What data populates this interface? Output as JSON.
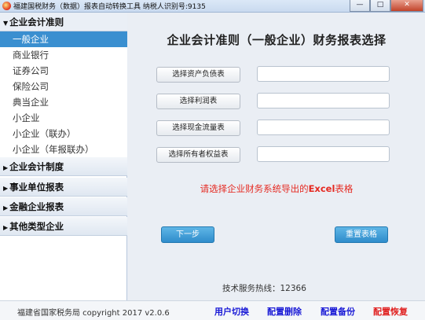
{
  "window": {
    "title": "福建国税财务（数据）报表自动转换工具     纳税人识别号:9135",
    "minimize": "—",
    "maximize": "□",
    "close": "✕"
  },
  "sidebar": {
    "categories": [
      {
        "label": "企业会计准则",
        "expanded": true,
        "arrow": "▼"
      },
      {
        "label": "企业会计制度",
        "expanded": false,
        "arrow": "▶"
      },
      {
        "label": "事业单位报表",
        "expanded": false,
        "arrow": "▶"
      },
      {
        "label": "金融企业报表",
        "expanded": false,
        "arrow": "▶"
      },
      {
        "label": "其他类型企业",
        "expanded": false,
        "arrow": "▶"
      }
    ],
    "sub_items": [
      "一般企业",
      "商业银行",
      "证券公司",
      "保险公司",
      "典当企业",
      "小企业",
      "小企业（联办）",
      "小企业（年报联办）"
    ],
    "selected_index": 0
  },
  "main": {
    "title": "企业会计准则（一般企业）财务报表选择",
    "select_buttons": [
      "选择资产负债表",
      "选择利润表",
      "选择现金流量表",
      "选择所有者权益表"
    ],
    "input_values": [
      "",
      "",
      "",
      ""
    ],
    "hint_prefix": "请选择企业财务系统导出的",
    "hint_excel": "Excel",
    "hint_suffix": "表格",
    "next_button": "下一步",
    "reset_button": "重置表格",
    "hotline": "技术服务热线：12366"
  },
  "statusbar": {
    "copyright": "福建省国家税务局  copyright 2017  v2.0.6",
    "links": [
      {
        "label": "用户切换",
        "color": "#1a1ad6"
      },
      {
        "label": "配置删除",
        "color": "#1a1ad6"
      },
      {
        "label": "配置备份",
        "color": "#1a1ad6"
      },
      {
        "label": "配置恢复",
        "color": "#e02020"
      }
    ]
  },
  "colors": {
    "accent": "#3a8fd0",
    "hint_red": "#e52a22",
    "button_blue": "#2f8ccb"
  }
}
